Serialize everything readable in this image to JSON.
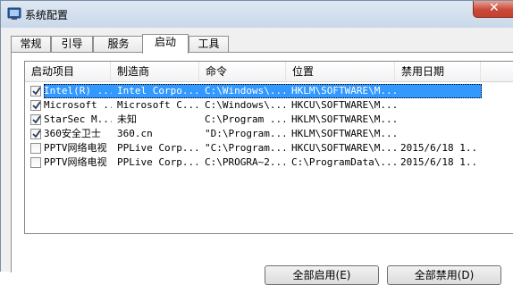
{
  "window": {
    "title": "系统配置"
  },
  "tabs": [
    {
      "label": "常规",
      "active": false
    },
    {
      "label": "引导",
      "active": false
    },
    {
      "label": "服务",
      "active": false
    },
    {
      "label": "启动",
      "active": true
    },
    {
      "label": "工具",
      "active": false
    }
  ],
  "columns": [
    "启动项目",
    "制造商",
    "命令",
    "位置",
    "禁用日期"
  ],
  "rows": [
    {
      "checked": true,
      "selected": true,
      "cells": [
        "Intel(R) ...",
        "Intel Corpo...",
        "C:\\Windows\\...",
        "HKLM\\SOFTWARE\\M...",
        ""
      ]
    },
    {
      "checked": true,
      "selected": false,
      "cells": [
        "Microsoft ...",
        "Microsoft C...",
        "C:\\Windows\\...",
        "HKCU\\SOFTWARE\\M...",
        ""
      ]
    },
    {
      "checked": true,
      "selected": false,
      "cells": [
        "StarSec M...",
        "未知",
        "C:\\Program ...",
        "HKLM\\SOFTWARE\\M...",
        ""
      ]
    },
    {
      "checked": true,
      "selected": false,
      "cells": [
        "360安全卫士",
        "360.cn",
        "\"D:\\Program...",
        "HKLM\\SOFTWARE\\M...",
        ""
      ]
    },
    {
      "checked": false,
      "selected": false,
      "cells": [
        "PPTV网络电视",
        "PPLive Corp...",
        "\"C:\\Program...",
        "HKCU\\SOFTWARE\\M...",
        "2015/6/18 1..."
      ]
    },
    {
      "checked": false,
      "selected": false,
      "cells": [
        "PPTV网络电视",
        "PPLive Corp...",
        "C:\\PROGRA~2...",
        "C:\\ProgramData\\...",
        "2015/6/18 1..."
      ]
    }
  ],
  "buttons": {
    "enable_all": "全部启用(E)",
    "disable_all": "全部禁用(D)"
  },
  "colors": {
    "selection": "#3399ff",
    "close": "#c9493a"
  },
  "icons": {
    "app": "msconfig-icon",
    "close": "close-icon",
    "checkbox": "checkmark-icon"
  }
}
